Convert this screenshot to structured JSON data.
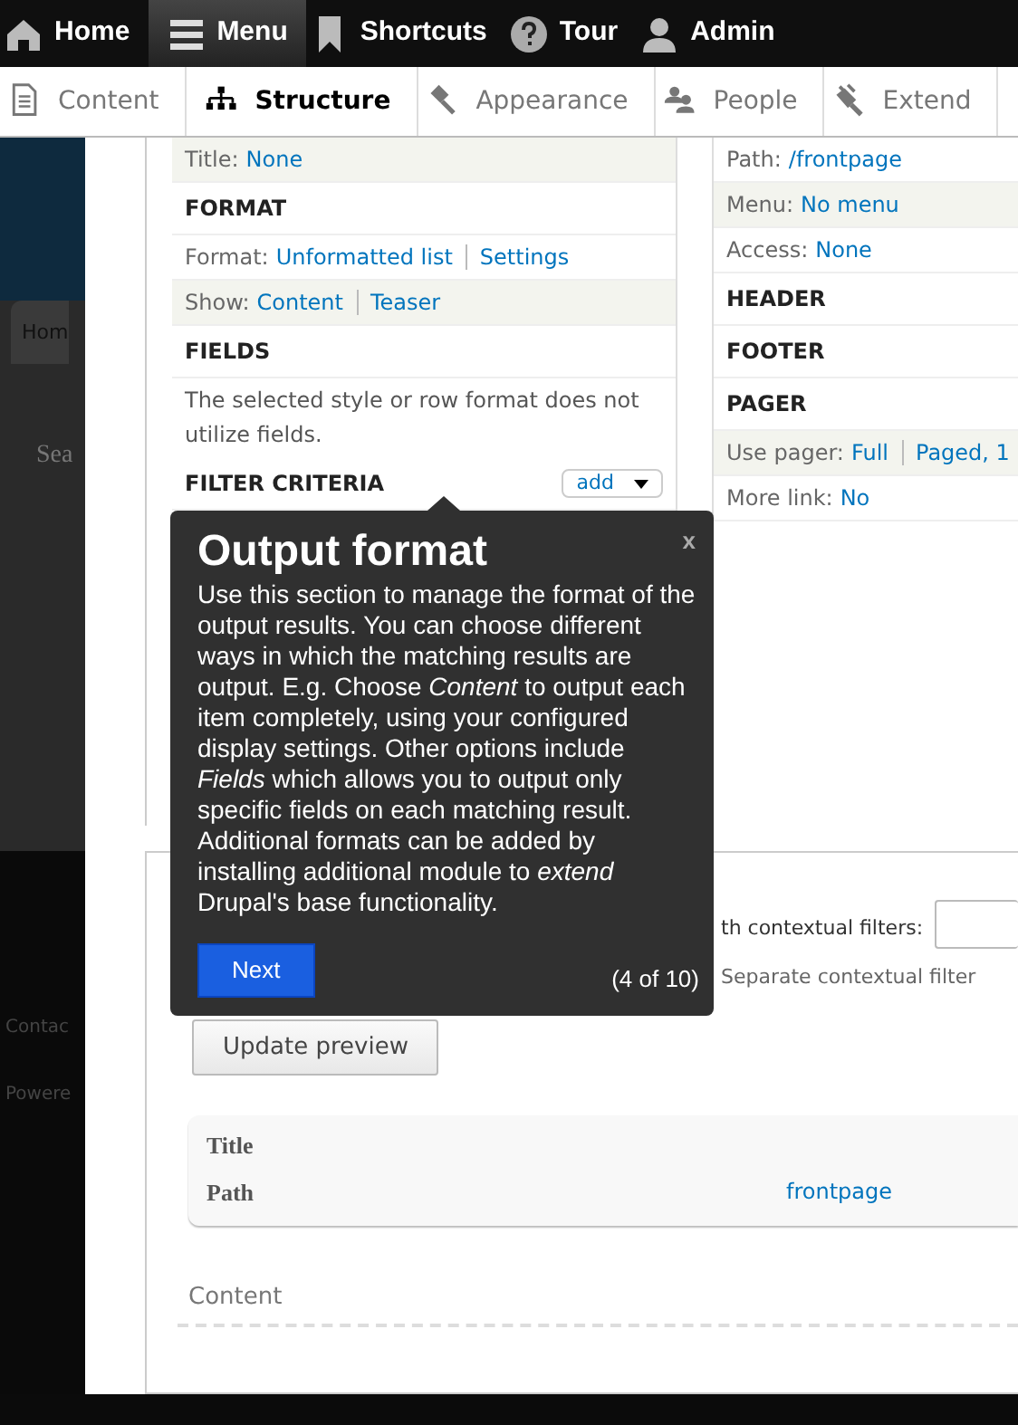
{
  "toolbar": {
    "items": [
      {
        "label": "Home",
        "selected": false
      },
      {
        "label": "Menu",
        "selected": true
      },
      {
        "label": "Shortcuts",
        "selected": false
      },
      {
        "label": "Tour",
        "selected": false
      },
      {
        "label": "Admin",
        "selected": false
      }
    ]
  },
  "tray": {
    "items": [
      {
        "label": "Content",
        "selected": false
      },
      {
        "label": "Structure",
        "selected": true
      },
      {
        "label": "Appearance",
        "selected": false
      },
      {
        "label": "People",
        "selected": false
      },
      {
        "label": "Extend",
        "selected": false
      }
    ]
  },
  "background_page": {
    "tab": "Hom",
    "search_label": "Sea",
    "footer_links": [
      "Contac",
      "Powere"
    ]
  },
  "view": {
    "left_column": [
      {
        "kind": "setting",
        "label": "Title:",
        "links": [
          "None"
        ],
        "shaded": true
      },
      {
        "kind": "heading",
        "title": "FORMAT"
      },
      {
        "kind": "setting",
        "label": "Format:",
        "links": [
          "Unformatted list",
          "Settings"
        ],
        "shaded": false
      },
      {
        "kind": "setting",
        "label": "Show:",
        "links": [
          "Content",
          "Teaser"
        ],
        "shaded": true
      },
      {
        "kind": "heading",
        "title": "FIELDS"
      },
      {
        "kind": "note",
        "text": "The selected style or row format does not utilize fields."
      },
      {
        "kind": "heading",
        "title": "FILTER CRITERIA",
        "button": "add"
      }
    ],
    "right_column": [
      {
        "kind": "setting",
        "label": "Path:",
        "links": [
          "/frontpage"
        ],
        "shaded": false
      },
      {
        "kind": "setting",
        "label": "Menu:",
        "links": [
          "No menu"
        ],
        "shaded": true
      },
      {
        "kind": "setting",
        "label": "Access:",
        "links": [
          "None"
        ],
        "shaded": false
      },
      {
        "kind": "heading",
        "title": "HEADER"
      },
      {
        "kind": "heading",
        "title": "FOOTER"
      },
      {
        "kind": "heading",
        "title": "PAGER"
      },
      {
        "kind": "setting",
        "label": "Use pager:",
        "links": [
          "Full",
          "Paged, 1"
        ],
        "shaded": true
      },
      {
        "kind": "setting",
        "label": "More link:",
        "links": [
          "No"
        ],
        "shaded": false
      }
    ]
  },
  "preview_controls": {
    "contextual_filters_label": "th contextual filters:",
    "contextual_filters_hint": "Separate contextual filter",
    "update_button": "Update preview"
  },
  "preview": {
    "rows": [
      {
        "label": "Title"
      },
      {
        "label": "Path",
        "value": "frontpage"
      }
    ]
  },
  "content_heading": "Content",
  "tour_tip": {
    "title": "Output format",
    "close": "x",
    "body": "Use this section to manage the format of the output results. You can choose different ways in which the matching results are output. E.g. Choose *Content* to output each item completely, using your configured display settings. Other options include *Fields* which allows you to output only specific fields on each matching result. Additional formats can be added by installing additional module to *extend* Drupal's base functionality.",
    "next_button": "Next",
    "counter": "(4 of 10)"
  }
}
